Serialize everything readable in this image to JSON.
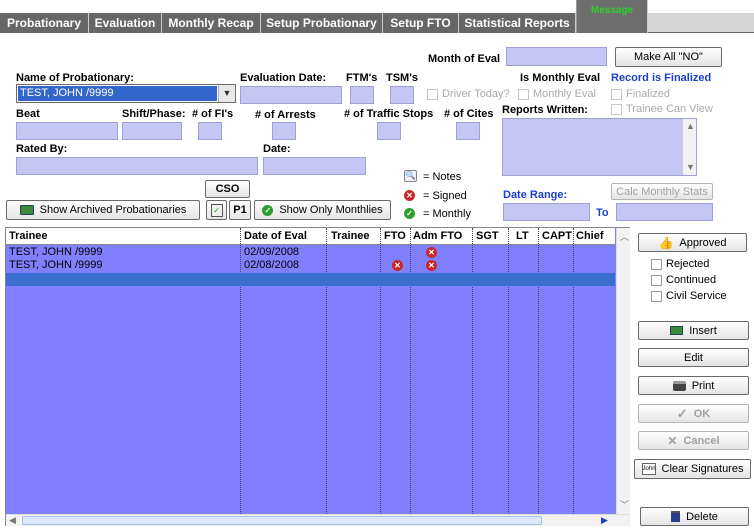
{
  "tabs": [
    {
      "label": "Probationary"
    },
    {
      "label": "Evaluation"
    },
    {
      "label": "Monthly Recap"
    },
    {
      "label": "Setup Probationary"
    },
    {
      "label": "Setup FTO"
    },
    {
      "label": "Statistical Reports"
    },
    {
      "label": "Message"
    }
  ],
  "form": {
    "month_of_eval_label": "Month of Eval",
    "make_all_no": "Make All \"NO\"",
    "name_label": "Name of Probationary:",
    "name_value": "TEST, JOHN /9999",
    "eval_date_label": "Evaluation Date:",
    "ftms_label": "FTM's",
    "tsms_label": "TSM's",
    "driver_today": "Driver Today?",
    "is_monthly_eval": "Is Monthly Eval",
    "monthly_eval": "Monthly Eval",
    "record_finalized": "Record is Finalized",
    "finalized": "Finalized",
    "trainee_can_view": "Trainee Can View",
    "beat_label": "Beat",
    "shift_label": "Shift/Phase:",
    "fis_label": "# of FI's",
    "arrests_label": "# of Arrests",
    "traffic_label": "# of Traffic Stops",
    "cites_label": "# of Cites",
    "reports_label": "Reports Written:",
    "rated_by_label": "Rated By:",
    "date_label": "Date:",
    "cso": "CSO",
    "calc_monthly": "Calc Monthly Stats",
    "date_range": "Date Range:",
    "to": "To",
    "notes_legend": "= Notes",
    "signed_legend": "= Signed",
    "monthly_legend": "= Monthly",
    "show_archived": "Show Archived Probationaries",
    "p1": "P1",
    "show_monthlies": "Show Only Monthlies"
  },
  "grid": {
    "headers": [
      "Trainee",
      "Date of Eval",
      "Trainee",
      "FTO",
      "Adm FTO",
      "SGT",
      "LT",
      "CAPT",
      "Chief"
    ],
    "rows": [
      {
        "trainee": "TEST, JOHN /9999",
        "date": "02/09/2008",
        "fto_signed": false,
        "adm_signed": true
      },
      {
        "trainee": "TEST, JOHN /9999",
        "date": "02/08/2008",
        "fto_signed": true,
        "adm_signed": true
      }
    ]
  },
  "side": {
    "approved": "Approved",
    "rejected": "Rejected",
    "continued": "Continued",
    "civil_service": "Civil Service",
    "insert": "Insert",
    "edit": "Edit",
    "print": "Print",
    "ok": "OK",
    "cancel": "Cancel",
    "clear_signatures": "Clear Signatures",
    "delete": "Delete"
  },
  "colors": {
    "field": "#c6c6f4",
    "grid": "#8080ff",
    "selected_row": "#3a6fd0",
    "tab": "#666666",
    "message_text": "#2ed12e",
    "link_blue": "#1b3fcf"
  }
}
